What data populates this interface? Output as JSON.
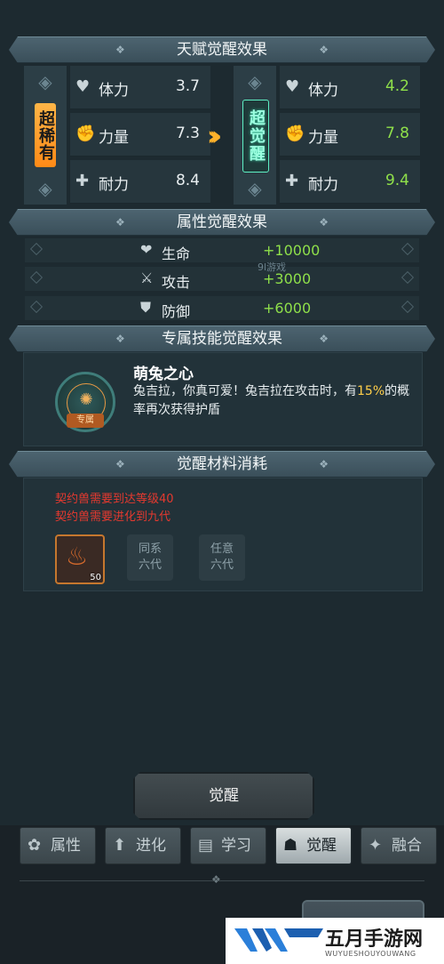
{
  "talent": {
    "header": "天赋觉醒效果",
    "left_badge": "超稀有",
    "right_badge": "超觉醒",
    "stats": [
      {
        "icon": "heart-icon",
        "glyph": "♥",
        "label": "体力",
        "before": "3.7",
        "after": "4.2"
      },
      {
        "icon": "fist-icon",
        "glyph": "✊",
        "label": "力量",
        "before": "7.3",
        "after": "7.8"
      },
      {
        "icon": "cross-icon",
        "glyph": "✚",
        "label": "耐力",
        "before": "8.4",
        "after": "9.4"
      }
    ]
  },
  "attributes": {
    "header": "属性觉醒效果",
    "rows": [
      {
        "icon": "heart-orb-icon",
        "glyph": "❤",
        "label": "生命",
        "value": "+10000"
      },
      {
        "icon": "sword-icon",
        "glyph": "⚔",
        "label": "攻击",
        "value": "+3000"
      },
      {
        "icon": "shield-icon",
        "glyph": "⛊",
        "label": "防御",
        "value": "+6000"
      }
    ],
    "watermark": "9l游戏"
  },
  "skill": {
    "header": "专属技能觉醒效果",
    "emblem_tag": "专属",
    "name": "萌兔之心",
    "desc_prefix": "兔吉拉，你真可爱！兔吉拉在攻击时，有",
    "desc_highlight": "15%",
    "desc_suffix": "的概率再次获得护盾"
  },
  "materials": {
    "header": "觉醒材料消耗",
    "requirements": [
      "契约兽需要到达等级40",
      "契约兽需要进化到九代"
    ],
    "item_count": "50",
    "slot2": "同系\n六代",
    "slot3": "任意\n六代"
  },
  "main_button": "觉醒",
  "tabs": [
    {
      "name": "tab-attributes",
      "icon": "paw-icon",
      "glyph": "✿",
      "label": "属性"
    },
    {
      "name": "tab-evolve",
      "icon": "evolve-icon",
      "glyph": "⬆",
      "label": "进化"
    },
    {
      "name": "tab-learn",
      "icon": "book-icon",
      "glyph": "▤",
      "label": "学习"
    },
    {
      "name": "tab-awaken",
      "icon": "beast-icon",
      "glyph": "☗",
      "label": "觉醒",
      "active": true
    },
    {
      "name": "tab-fusion",
      "icon": "fusion-icon",
      "glyph": "✦",
      "label": "融合"
    }
  ],
  "brand": {
    "cn": "五月手游网",
    "en": "WUYUESHOUYOUWANG"
  },
  "colors": {
    "gain": "#8fe04a",
    "warning": "#e5392f",
    "accent": "#ffb12a",
    "highlight": "#ffcf4a"
  }
}
